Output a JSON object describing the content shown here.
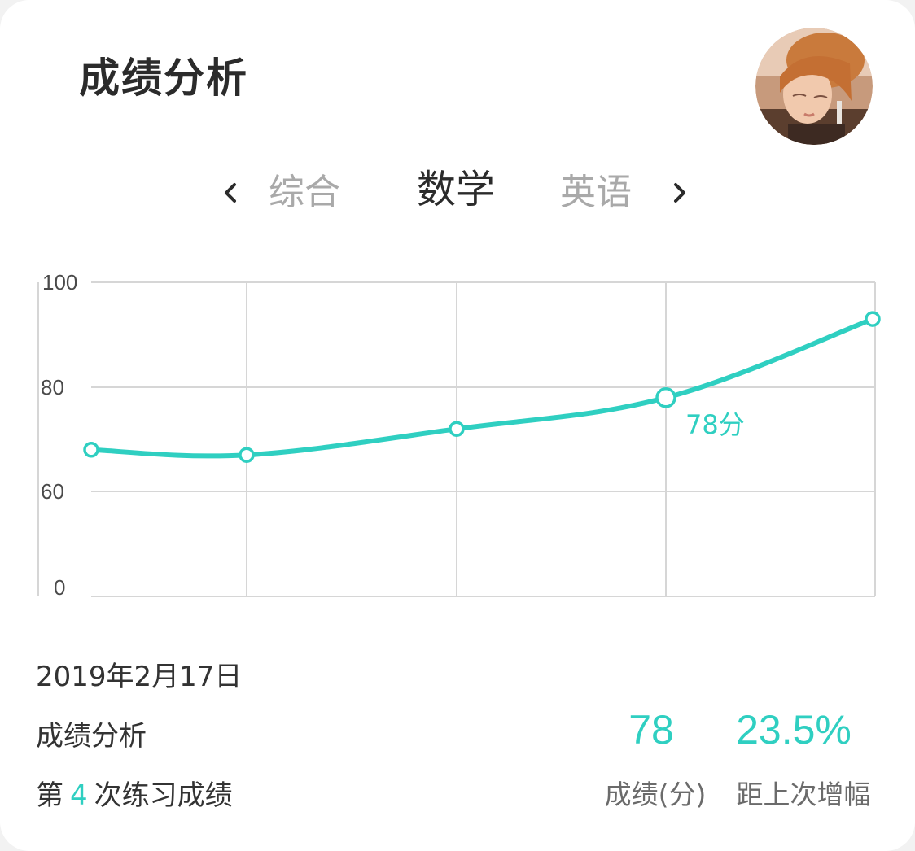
{
  "header": {
    "title": "成绩分析"
  },
  "avatar": {
    "icon": "user-avatar-photo"
  },
  "tabs": {
    "prev_icon": "chevron-left-icon",
    "next_icon": "chevron-right-icon",
    "items": [
      {
        "label": "综合",
        "active": false
      },
      {
        "label": "数学",
        "active": true
      },
      {
        "label": "英语",
        "active": false
      }
    ]
  },
  "chart_data": {
    "type": "line",
    "y_ticks": [
      "100",
      "80",
      "60",
      "0"
    ],
    "ylim": [
      0,
      100
    ],
    "points": [
      {
        "index": 1,
        "value": 68
      },
      {
        "index": 2,
        "value": 67
      },
      {
        "index": 3,
        "value": 72
      },
      {
        "index": 4,
        "value": 78
      },
      {
        "index": 5,
        "value": 93
      }
    ],
    "highlight_index": 3,
    "highlight_label": "78分",
    "grid": true,
    "line_color": "#2fcfc1"
  },
  "summary": {
    "date": "2019年2月17日",
    "subtitle": "成绩分析",
    "practice_prefix": "第",
    "practice_number": "4",
    "practice_suffix": "次练习成绩",
    "score_value": "78",
    "score_label": "成绩(分)",
    "increase_value": "23.5%",
    "increase_label": "距上次增幅"
  },
  "colors": {
    "accent": "#2fcfc1",
    "text_dark": "#2b2b2b",
    "text_muted": "#a9a9a9"
  }
}
